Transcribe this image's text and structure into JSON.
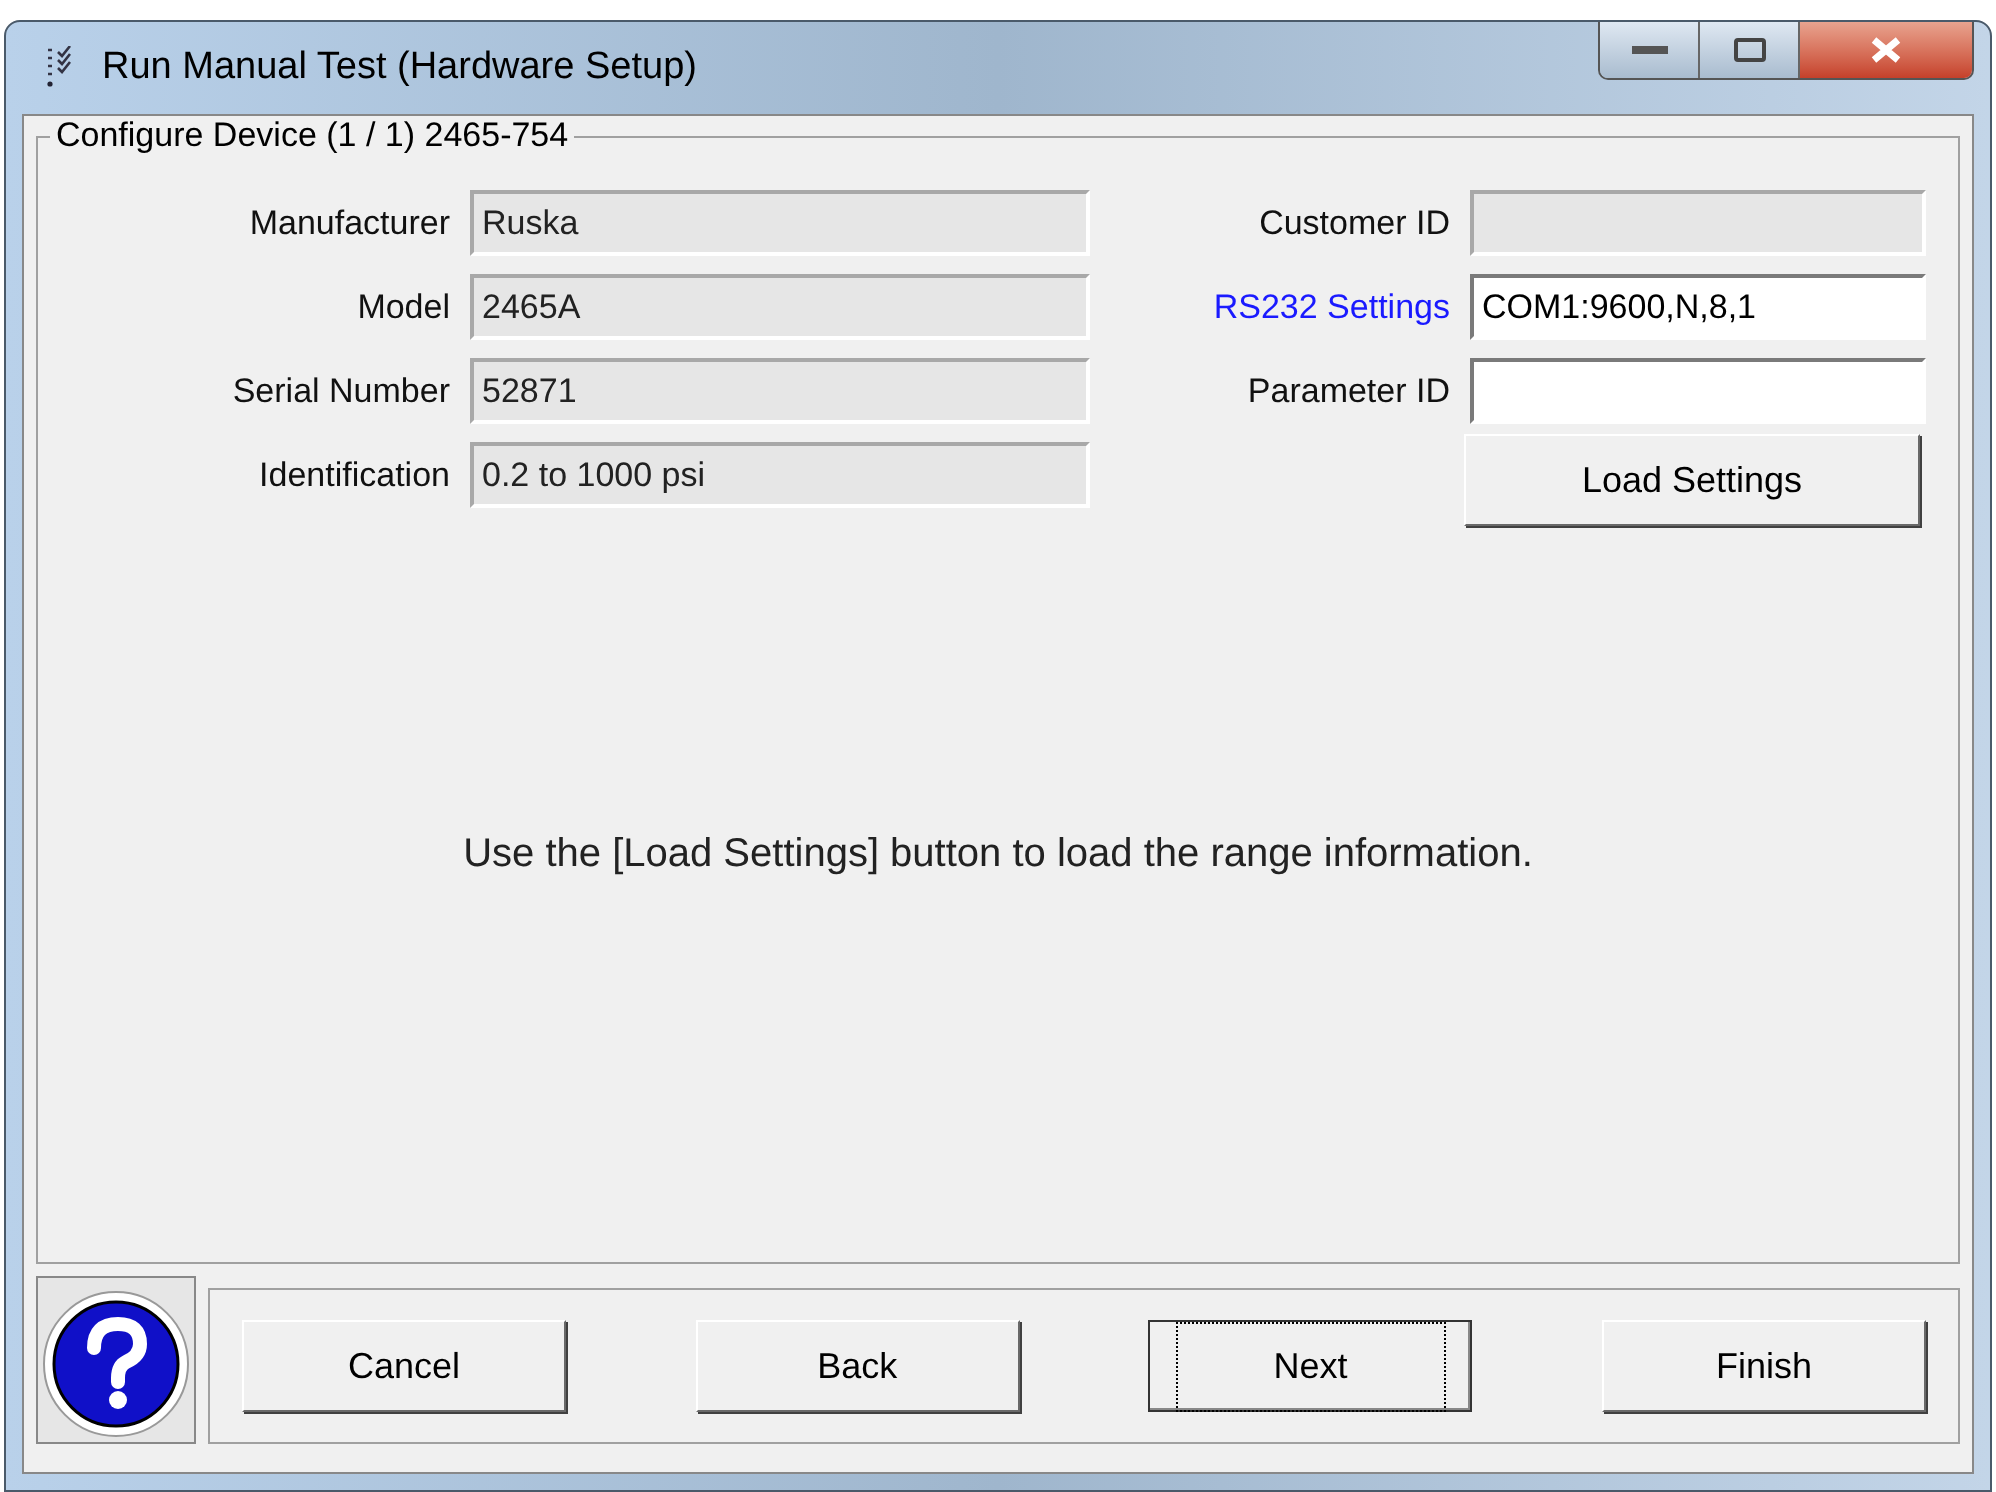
{
  "window": {
    "title": "Run Manual Test (Hardware Setup)"
  },
  "group": {
    "title": "Configure Device (1 / 1) 2465-754"
  },
  "left_fields": [
    {
      "label": "Manufacturer",
      "value": "Ruska",
      "disabled": true
    },
    {
      "label": "Model",
      "value": "2465A",
      "disabled": true
    },
    {
      "label": "Serial Number",
      "value": "52871",
      "disabled": true
    },
    {
      "label": "Identification",
      "value": "0.2 to 1000 psi",
      "disabled": true
    }
  ],
  "right_fields": [
    {
      "label": "Customer ID",
      "kind": "label",
      "disabled": true
    },
    {
      "label": "RS232 Settings",
      "kind": "link",
      "value": "COM1:9600,N,8,1",
      "disabled": false
    },
    {
      "label": "Parameter ID",
      "kind": "label",
      "disabled": false
    }
  ],
  "load_button": "Load Settings",
  "message": "Use the [Load Settings] button to load the range information.",
  "buttons": [
    {
      "label": "Cancel",
      "focused": false
    },
    {
      "label": "Back",
      "focused": false
    },
    {
      "label": "Next",
      "focused": true
    },
    {
      "label": "Finish",
      "focused": false
    }
  ]
}
